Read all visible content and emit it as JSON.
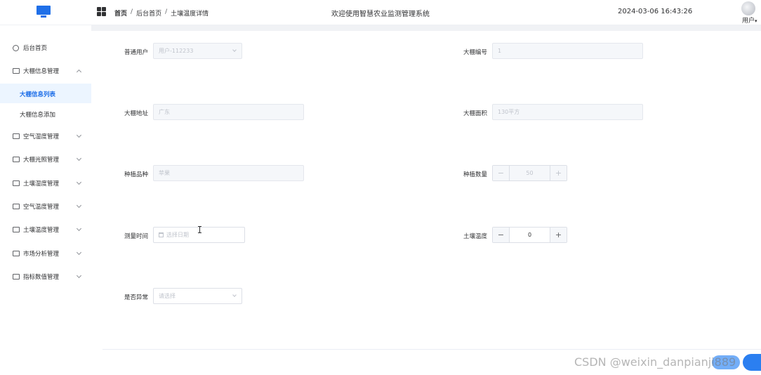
{
  "header": {
    "breadcrumb": [
      "首页",
      "后台首页",
      "土壤温度详情"
    ],
    "title": "欢迎使用智慧农业监测管理系统",
    "datetime": "2024-03-06 16:43:26",
    "user": "用户"
  },
  "sidebar": {
    "home": "后台首页",
    "groups": [
      {
        "label": "大棚信息管理",
        "expanded": true,
        "children": [
          "大棚信息列表",
          "大棚信息添加"
        ]
      },
      {
        "label": "空气湿度管理"
      },
      {
        "label": "大棚光照管理"
      },
      {
        "label": "土壤湿度管理"
      },
      {
        "label": "空气温度管理"
      },
      {
        "label": "土壤温度管理"
      },
      {
        "label": "市场分析管理"
      },
      {
        "label": "指标数值管理"
      }
    ],
    "active_item": "大棚信息列表"
  },
  "form": {
    "user_label": "普通用户",
    "user_value": "用户-112233",
    "greenhouse_no_label": "大棚编号",
    "greenhouse_no_value": "1",
    "address_label": "大棚地址",
    "address_value": "广东",
    "area_label": "大棚面积",
    "area_value": "130平方",
    "variety_label": "种植品种",
    "variety_value": "苹果",
    "quantity_label": "种植数量",
    "quantity_value": "50",
    "time_label": "测量时间",
    "time_placeholder": "选择日期",
    "soil_temp_label": "土壤温度",
    "soil_temp_value": "0",
    "abnormal_label": "是否异常",
    "abnormal_placeholder": "请选择",
    "minus": "−",
    "plus": "+"
  },
  "watermark": "CSDN @weixin_danpianji889"
}
